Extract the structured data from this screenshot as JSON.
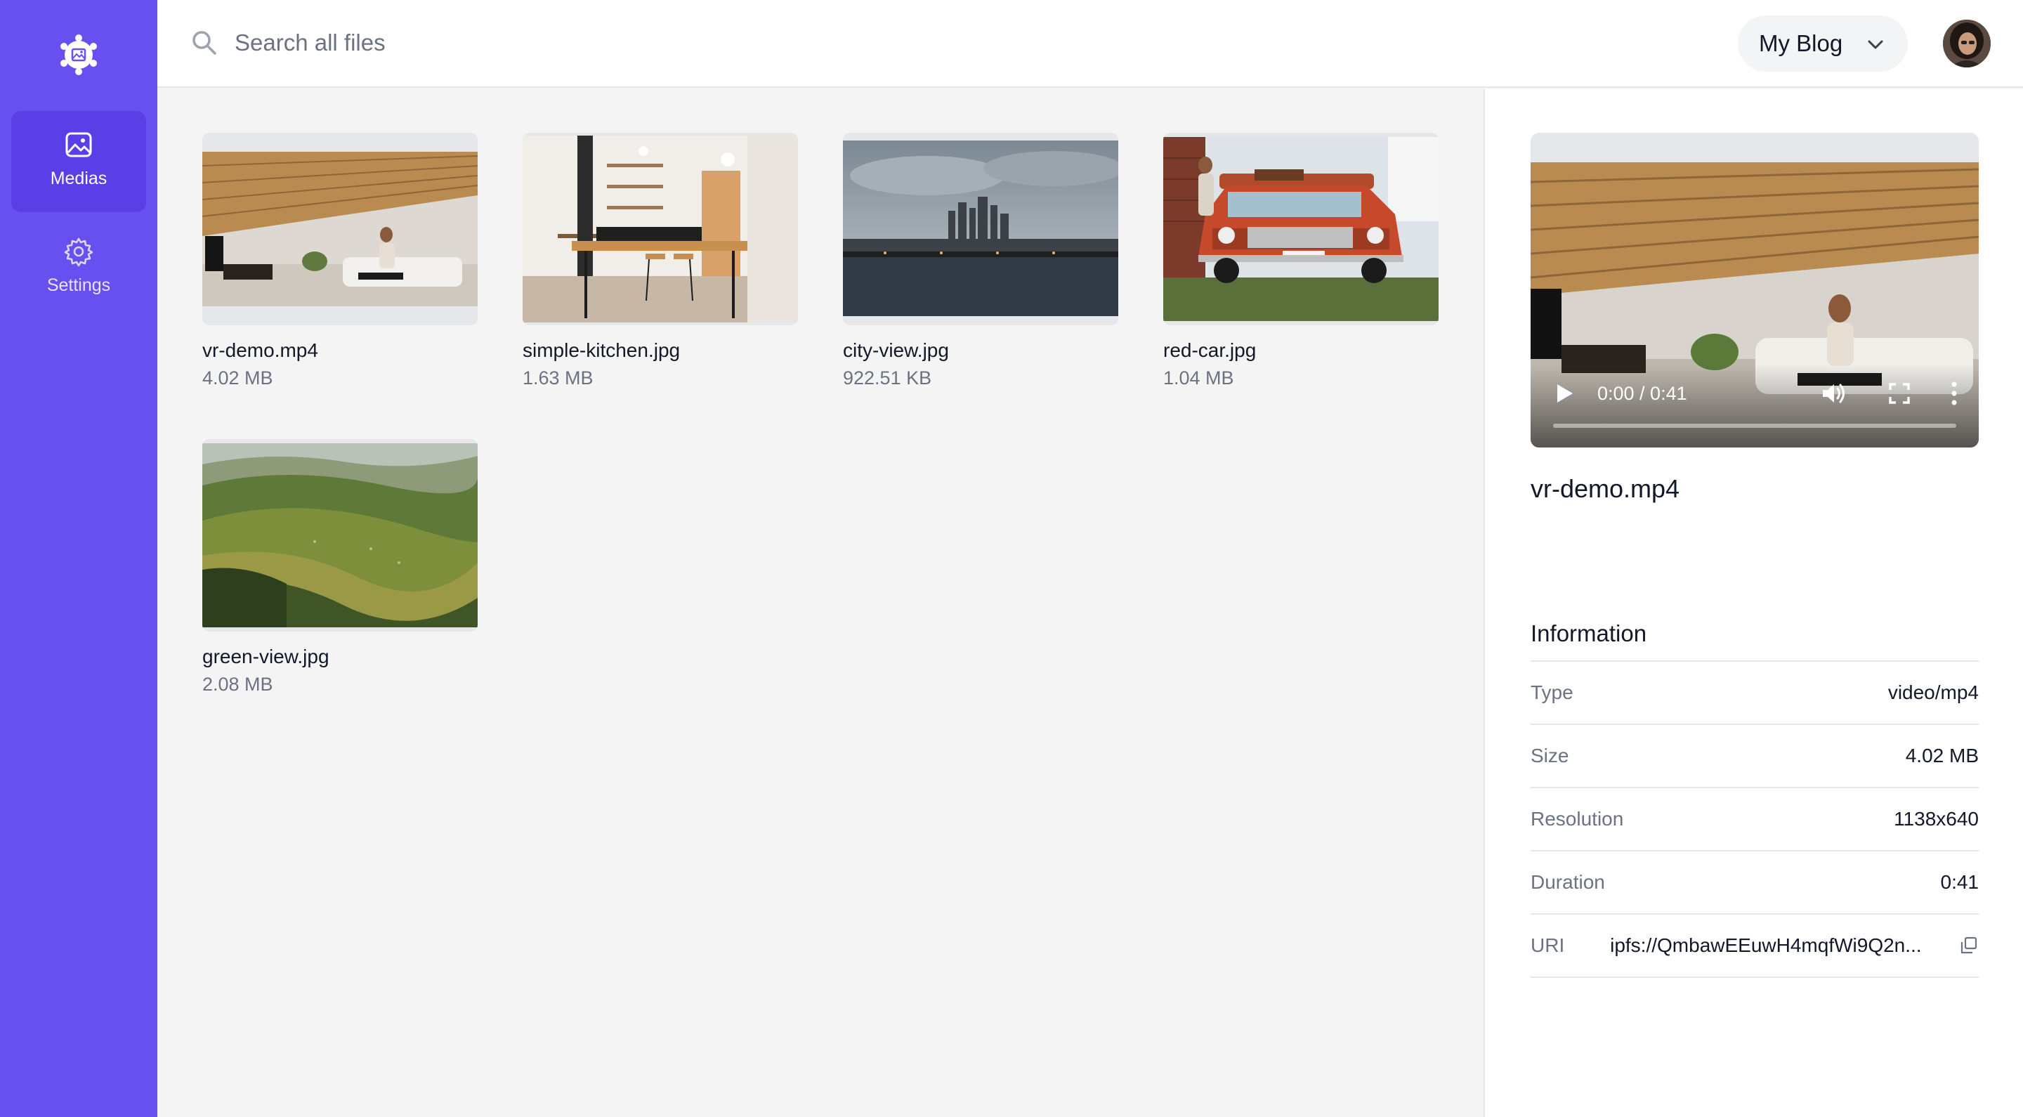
{
  "sidebar": {
    "items": [
      {
        "label": "Medias",
        "icon": "image-icon",
        "active": true
      },
      {
        "label": "Settings",
        "icon": "gear-icon",
        "active": false
      }
    ],
    "colors": {
      "background": "#6650f0",
      "active": "#5a3ee6"
    }
  },
  "header": {
    "search": {
      "placeholder": "Search all files",
      "value": ""
    },
    "site_selector": {
      "label": "My Blog"
    }
  },
  "files": [
    {
      "name": "vr-demo.mp4",
      "size": "4.02 MB"
    },
    {
      "name": "simple-kitchen.jpg",
      "size": "1.63 MB"
    },
    {
      "name": "city-view.jpg",
      "size": "922.51 KB"
    },
    {
      "name": "red-car.jpg",
      "size": "1.04 MB"
    },
    {
      "name": "green-view.jpg",
      "size": "2.08 MB"
    }
  ],
  "detail": {
    "title": "vr-demo.mp4",
    "player": {
      "time": "0:00 / 0:41",
      "progress": 0
    },
    "information_heading": "Information",
    "info": [
      {
        "key": "Type",
        "value": "video/mp4"
      },
      {
        "key": "Size",
        "value": "4.02 MB"
      },
      {
        "key": "Resolution",
        "value": "1138x640"
      },
      {
        "key": "Duration",
        "value": "0:41"
      },
      {
        "key": "URI",
        "value": "ipfs://QmbawEEuwH4mqfWi9Q2n..."
      }
    ]
  }
}
